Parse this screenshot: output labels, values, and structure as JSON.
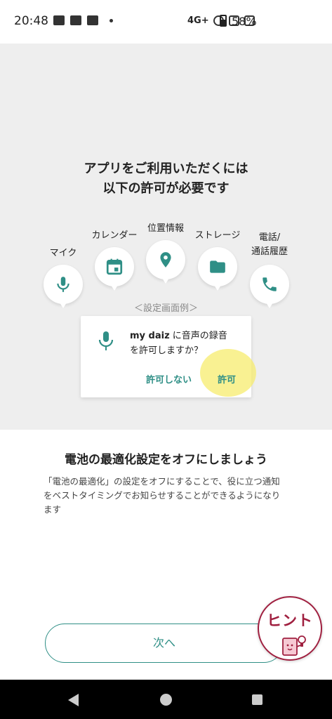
{
  "status_bar": {
    "time": "20:48",
    "network": "4G+",
    "battery": "58%"
  },
  "hero": {
    "title_line1": "アプリをご利用いただくには",
    "title_line2": "以下の許可が必要です",
    "permissions": [
      {
        "label": "マイク",
        "icon": "mic-icon"
      },
      {
        "label": "カレンダー",
        "icon": "calendar-icon"
      },
      {
        "label": "位置情報",
        "icon": "location-pin-icon"
      },
      {
        "label": "ストレージ",
        "icon": "folder-icon"
      },
      {
        "label_line1": "電話/",
        "label_line2": "通話履歴",
        "icon": "phone-icon"
      }
    ],
    "example_label": "＜設定画面例＞",
    "dialog": {
      "app_name": "my daiz",
      "text_line1_suffix": " に音声の録音",
      "text_line2": "を許可しますか？",
      "deny_label": "許可しない",
      "allow_label": "許可"
    }
  },
  "section": {
    "title": "電池の最適化設定をオフにしましょう",
    "description": "「電池の最適化」の設定をオフにすることで、役に立つ通知をベストタイミングでお知らせすることができるようになります"
  },
  "next_button_label": "次へ",
  "hint_button_label": "ヒント",
  "colors": {
    "accent": "#2f8f86",
    "hint": "#a02040",
    "highlight": "#f7ec6e",
    "hero_bg": "#eeeeee"
  }
}
